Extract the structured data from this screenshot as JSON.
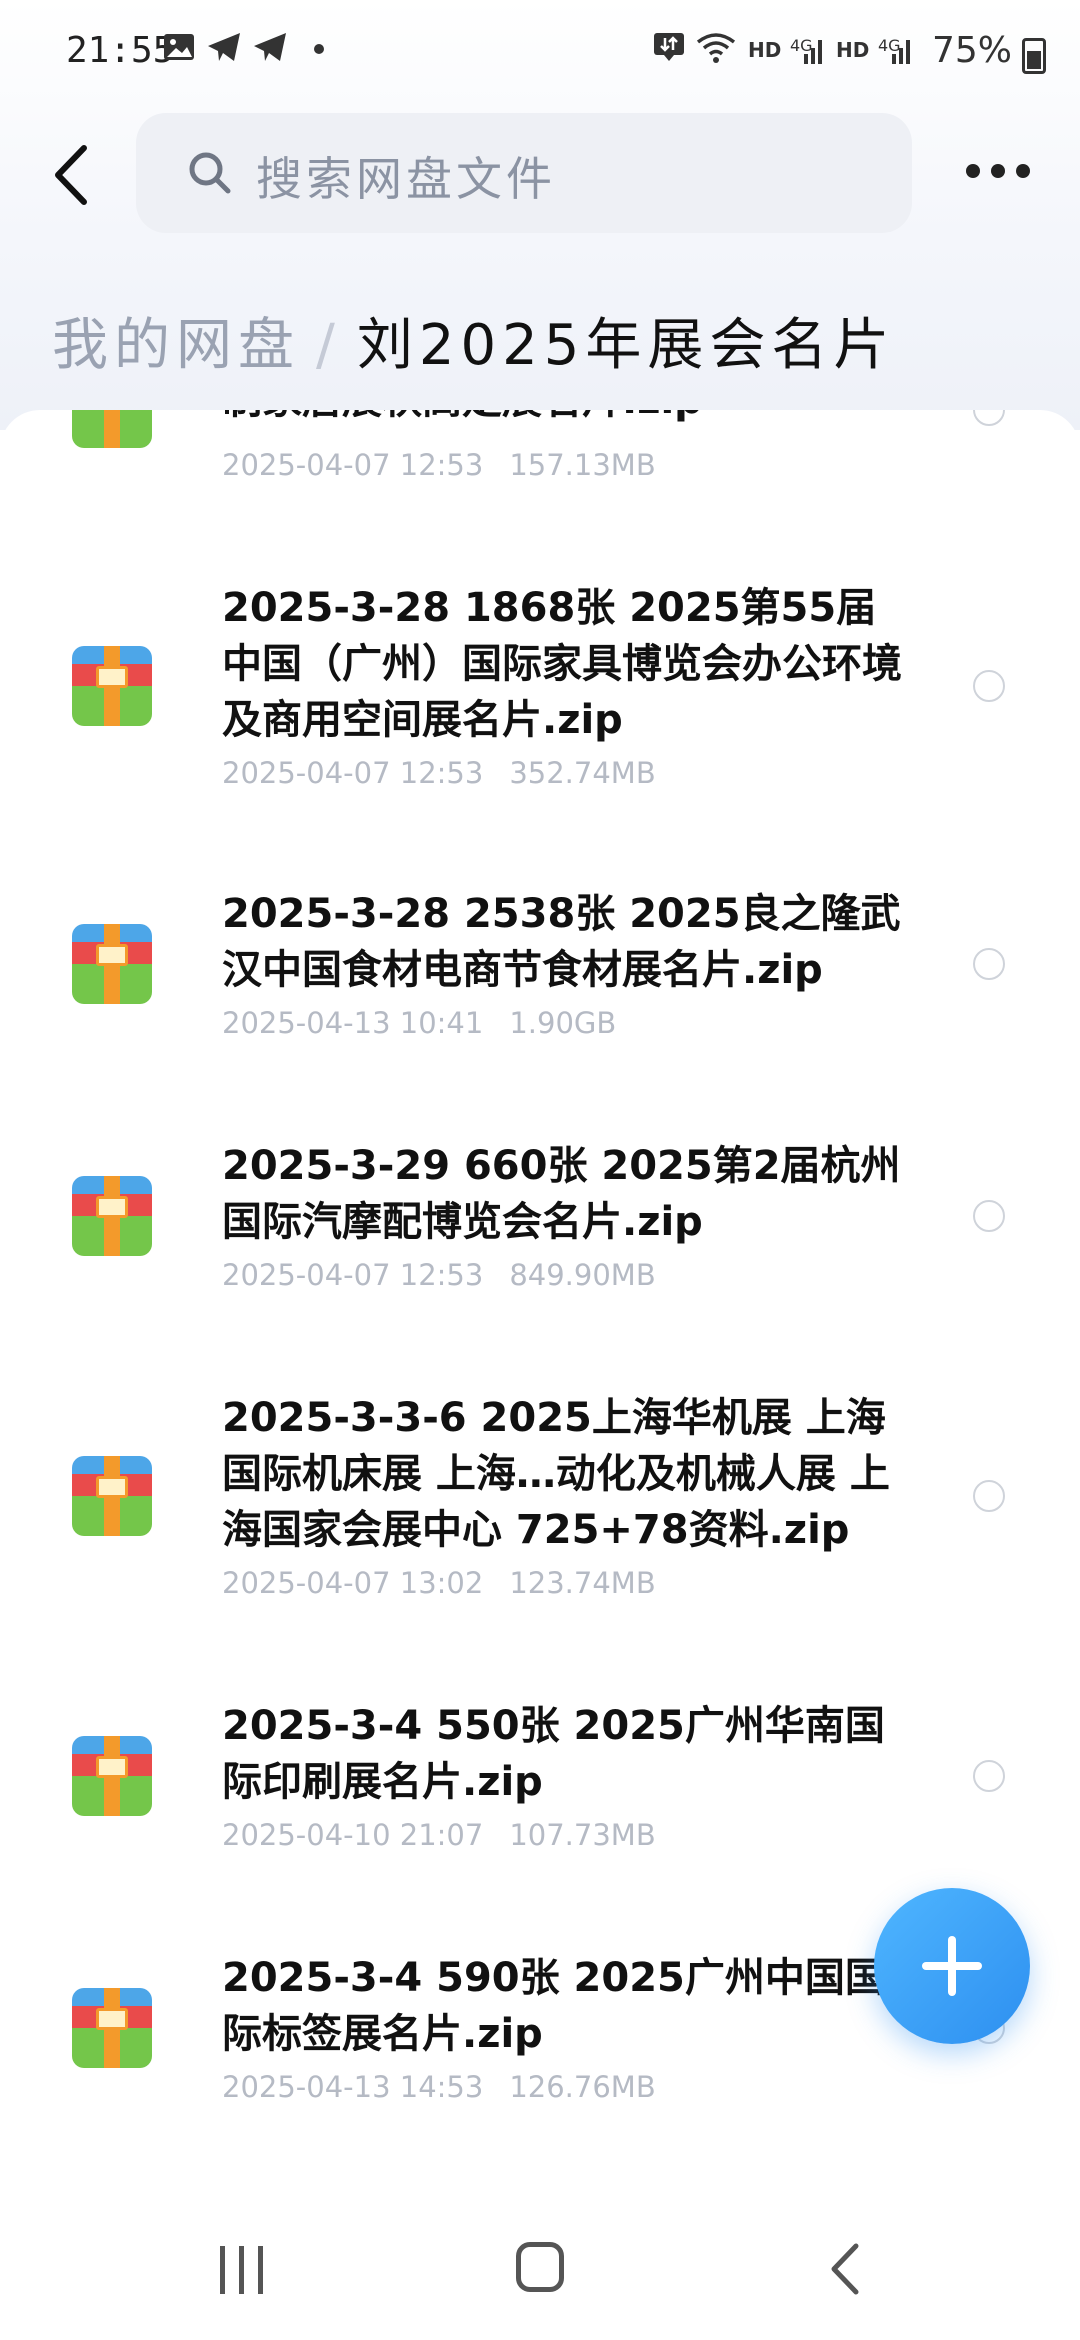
{
  "status_bar": {
    "time": "21:55",
    "network_labels": [
      "HD",
      "4G",
      "HD",
      "4G"
    ],
    "battery": "75%"
  },
  "header": {
    "search_placeholder": "搜索网盘文件"
  },
  "breadcrumb": {
    "root": "我的网盘",
    "separator": "/",
    "current": "刘2025年展会名片"
  },
  "files": [
    {
      "name": "制家居展秋高定展名片.zip",
      "date": "2025-04-07 12:53",
      "size": "157.13MB"
    },
    {
      "name": "2025-3-28 1868张 2025第55届中国（广州）国际家具博览会办公环境及商用空间展名片.zip",
      "date": "2025-04-07 12:53",
      "size": "352.74MB"
    },
    {
      "name": "2025-3-28 2538张 2025良之隆武汉中国食材电商节食材展名片.zip",
      "date": "2025-04-13 10:41",
      "size": "1.90GB"
    },
    {
      "name": "2025-3-29 660张 2025第2届杭州国际汽摩配博览会名片.zip",
      "date": "2025-04-07 12:53",
      "size": "849.90MB"
    },
    {
      "name": "2025-3-3-6 2025上海华机展 上海国际机床展 上海…动化及机械人展 上海国家会展中心 725+78资料.zip",
      "date": "2025-04-07 13:02",
      "size": "123.74MB"
    },
    {
      "name": "2025-3-4 550张 2025广州华南国际印刷展名片.zip",
      "date": "2025-04-10 21:07",
      "size": "107.73MB"
    },
    {
      "name": "2025-3-4 590张 2025广州中国国际标签展名片.zip",
      "date": "2025-04-13 14:53",
      "size": "126.76MB"
    }
  ],
  "icons": {
    "file_icon": "zip-archive-icon",
    "fab_icon": "plus-icon",
    "accent_color": "#2d8ff0"
  }
}
